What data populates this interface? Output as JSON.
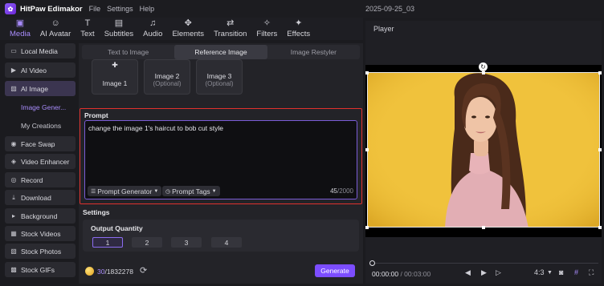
{
  "titlebar": {
    "app_name": "HitPaw Edimakor",
    "menus": [
      "File",
      "Settings",
      "Help"
    ],
    "project_name": "2025-09-25_03"
  },
  "toolbar": {
    "items": [
      {
        "label": "Media",
        "icon": "media-icon",
        "glyph": "▣"
      },
      {
        "label": "AI Avatar",
        "icon": "avatar-icon",
        "glyph": "☺"
      },
      {
        "label": "Text",
        "icon": "text-icon",
        "glyph": "T"
      },
      {
        "label": "Subtitles",
        "icon": "subtitles-icon",
        "glyph": "▤"
      },
      {
        "label": "Audio",
        "icon": "audio-icon",
        "glyph": "♫"
      },
      {
        "label": "Elements",
        "icon": "elements-icon",
        "glyph": "✥"
      },
      {
        "label": "Transition",
        "icon": "transition-icon",
        "glyph": "⇄"
      },
      {
        "label": "Filters",
        "icon": "filters-icon",
        "glyph": "✧"
      },
      {
        "label": "Effects",
        "icon": "effects-icon",
        "glyph": "✦"
      }
    ],
    "active": "Media"
  },
  "sidebar": {
    "items": [
      {
        "label": "Local Media",
        "icon": "folder-icon",
        "glyph": "▭"
      },
      {
        "label": "AI Video",
        "icon": "ai-video-icon",
        "glyph": "▶"
      },
      {
        "label": "AI Image",
        "icon": "ai-image-icon",
        "glyph": "▨"
      },
      {
        "label": "Face Swap",
        "icon": "face-swap-icon",
        "glyph": "◉"
      },
      {
        "label": "Video Enhancer",
        "icon": "enhancer-icon",
        "glyph": "◈"
      },
      {
        "label": "Record",
        "icon": "record-icon",
        "glyph": "◎"
      },
      {
        "label": "Download",
        "icon": "download-icon",
        "glyph": "⤓"
      },
      {
        "label": "Background",
        "icon": "background-icon",
        "glyph": "▸"
      },
      {
        "label": "Stock Videos",
        "icon": "stock-videos-icon",
        "glyph": "▦"
      },
      {
        "label": "Stock Photos",
        "icon": "stock-photos-icon",
        "glyph": "▧"
      },
      {
        "label": "Stock GIFs",
        "icon": "stock-gifs-icon",
        "glyph": "▩"
      }
    ],
    "sub_items": [
      "Image Gener...",
      "My Creations"
    ]
  },
  "panel": {
    "tabs": [
      "Text to Image",
      "Reference Image",
      "Image Restyler"
    ],
    "active_tab": "Reference Image",
    "image_slots": [
      {
        "title": "Image 1",
        "optional": ""
      },
      {
        "title": "Image 2",
        "optional": "(Optional)"
      },
      {
        "title": "Image 3",
        "optional": "(Optional)"
      }
    ],
    "prompt": {
      "title": "Prompt",
      "text": "change the image 1's haircut to bob cut style",
      "generator_label": "Prompt Generator",
      "tags_label": "Prompt Tags",
      "count_current": "45",
      "count_max": "/2000"
    },
    "settings": {
      "title": "Settings",
      "quantity_title": "Output Quantity",
      "options": [
        "1",
        "2",
        "3",
        "4"
      ],
      "selected": "1"
    },
    "footer": {
      "credits_used": "30",
      "credits_total": "/1832278",
      "generate_label": "Generate"
    }
  },
  "player": {
    "title": "Player",
    "time_current": "00:00:00",
    "time_total": " / 00:03:00",
    "aspect_ratio": "4:3"
  },
  "colors": {
    "accent": "#7c4dff",
    "highlight_border": "#e0312d",
    "photo_background": "#f0c23c"
  }
}
